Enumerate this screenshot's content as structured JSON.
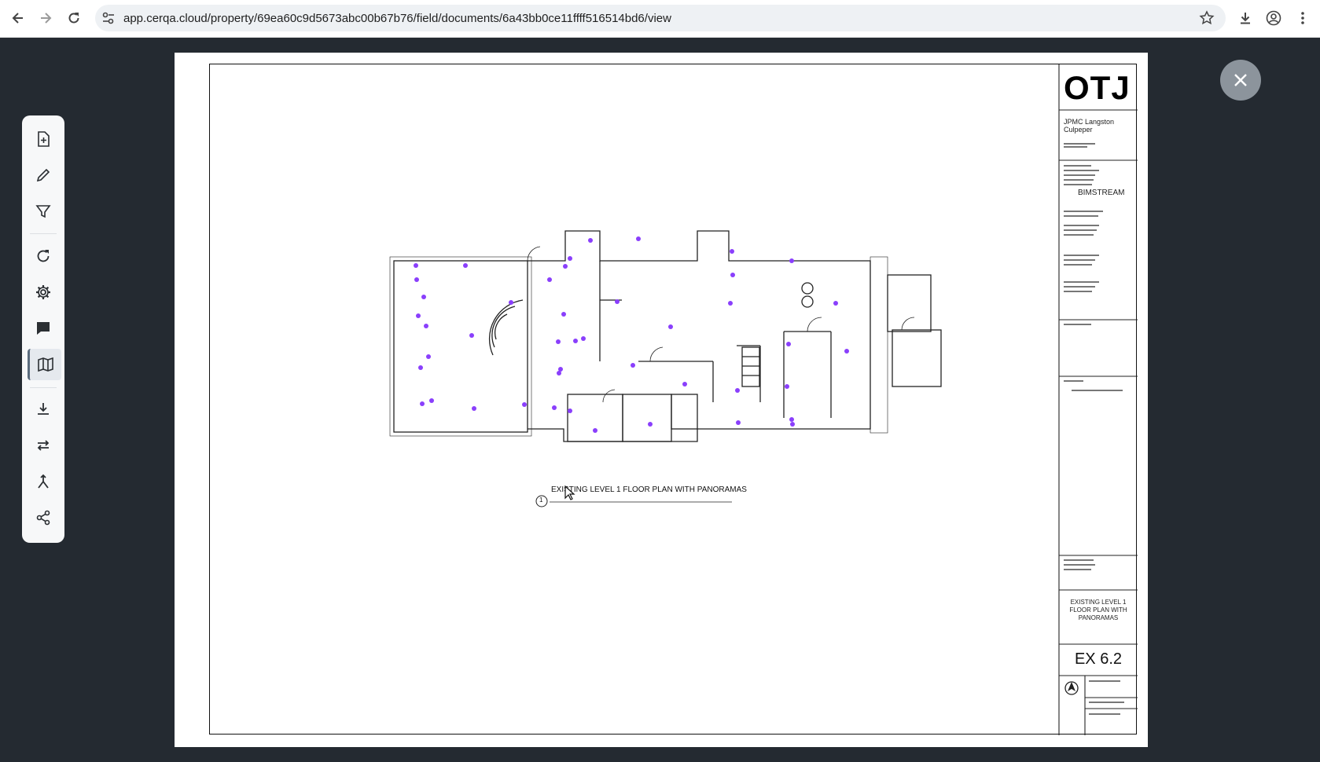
{
  "browser": {
    "url": "app.cerqa.cloud/property/69ea60c9d5673abc00b67b76/field/documents/6a43bb0ce11ffff516514bd6/view",
    "icons": [
      "back-arrow-icon",
      "forward-arrow-icon",
      "reload-icon",
      "site-settings-icon",
      "bookmark-star-icon",
      "download-icon",
      "profile-icon",
      "menu-dots-icon"
    ]
  },
  "toolbar": {
    "tools": [
      "add-document-icon",
      "pencil-icon",
      "filter-icon",
      "refresh-icon",
      "settings-gear-icon",
      "comment-icon",
      "map-icon",
      "download-icon",
      "swap-icon",
      "merge-icon",
      "share-icon"
    ],
    "active_tool": "map-icon"
  },
  "drawing": {
    "logo": "OTJ",
    "project_name_line1": "JPMC Langston",
    "project_name_line2": "Culpeper",
    "consultant_brand": "BIMSTREAM",
    "plan_title": "EXISTING LEVEL 1 FLOOR PLAN WITH PANORAMAS",
    "plan_number": "1",
    "sheet_title_line1": "EXISTING LEVEL 1",
    "sheet_title_line2": "FLOOR PLAN WITH",
    "sheet_title_line3": "PANORAMAS",
    "sheet_number": "EX 6.2",
    "marker_color": "#8a3ffc"
  },
  "colors": {
    "app_background": "#242a31",
    "close_button": "#8c949c"
  }
}
